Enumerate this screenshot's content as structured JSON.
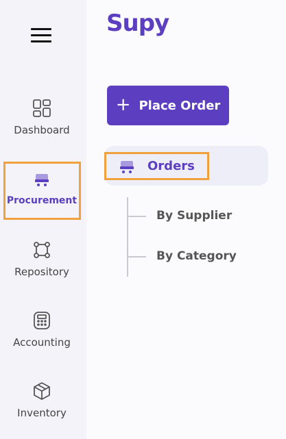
{
  "brand": {
    "logo_text": "Supy",
    "accent": "#5b3fc0",
    "highlight": "#f0a03c"
  },
  "rail": {
    "menu_icon": "hamburger-menu-icon",
    "items": [
      {
        "label": "Dashboard",
        "icon": "dashboard-grid-icon",
        "active": false
      },
      {
        "label": "Procurement",
        "icon": "cart-icon",
        "active": true
      },
      {
        "label": "Repository",
        "icon": "repository-nodes-icon",
        "active": false
      },
      {
        "label": "Accounting",
        "icon": "calculator-icon",
        "active": false
      },
      {
        "label": "Inventory",
        "icon": "box-icon",
        "active": false
      }
    ]
  },
  "main": {
    "place_order_label": "Place Order",
    "orders_label": "Orders",
    "sub_items": [
      {
        "label": "By Supplier"
      },
      {
        "label": "By Category"
      }
    ]
  }
}
